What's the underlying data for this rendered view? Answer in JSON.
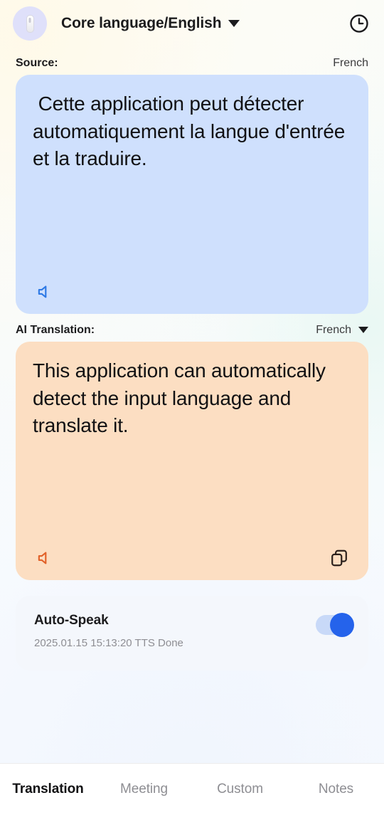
{
  "header": {
    "title": "Core language/English",
    "avatar_icon": "recorder-device-icon",
    "dropdown_icon": "chevron-down-icon",
    "history_icon": "clock-icon"
  },
  "source": {
    "label": "Source:",
    "language": "French",
    "text": " Cette application peut détecter automatiquement la langue d'entrée et la traduire.",
    "speak_icon": "speaker-icon",
    "bg_color": "#cfe0fd",
    "speaker_color": "#2f7ae5"
  },
  "translation": {
    "label": "AI Translation:",
    "language": "French",
    "dropdown_icon": "chevron-down-icon",
    "text": "This application can automatically detect the input language and translate it.",
    "speak_icon": "speaker-icon",
    "copy_icon": "copy-icon",
    "bg_color": "#fcdec2",
    "speaker_color": "#e2622a"
  },
  "auto_speak": {
    "title": "Auto-Speak",
    "status": "2025.01.15 15:13:20 TTS Done",
    "toggle_on": true,
    "toggle_color": "#2563eb"
  },
  "tabs": [
    {
      "label": "Translation",
      "active": true
    },
    {
      "label": "Meeting",
      "active": false
    },
    {
      "label": "Custom",
      "active": false
    },
    {
      "label": "Notes",
      "active": false
    }
  ]
}
